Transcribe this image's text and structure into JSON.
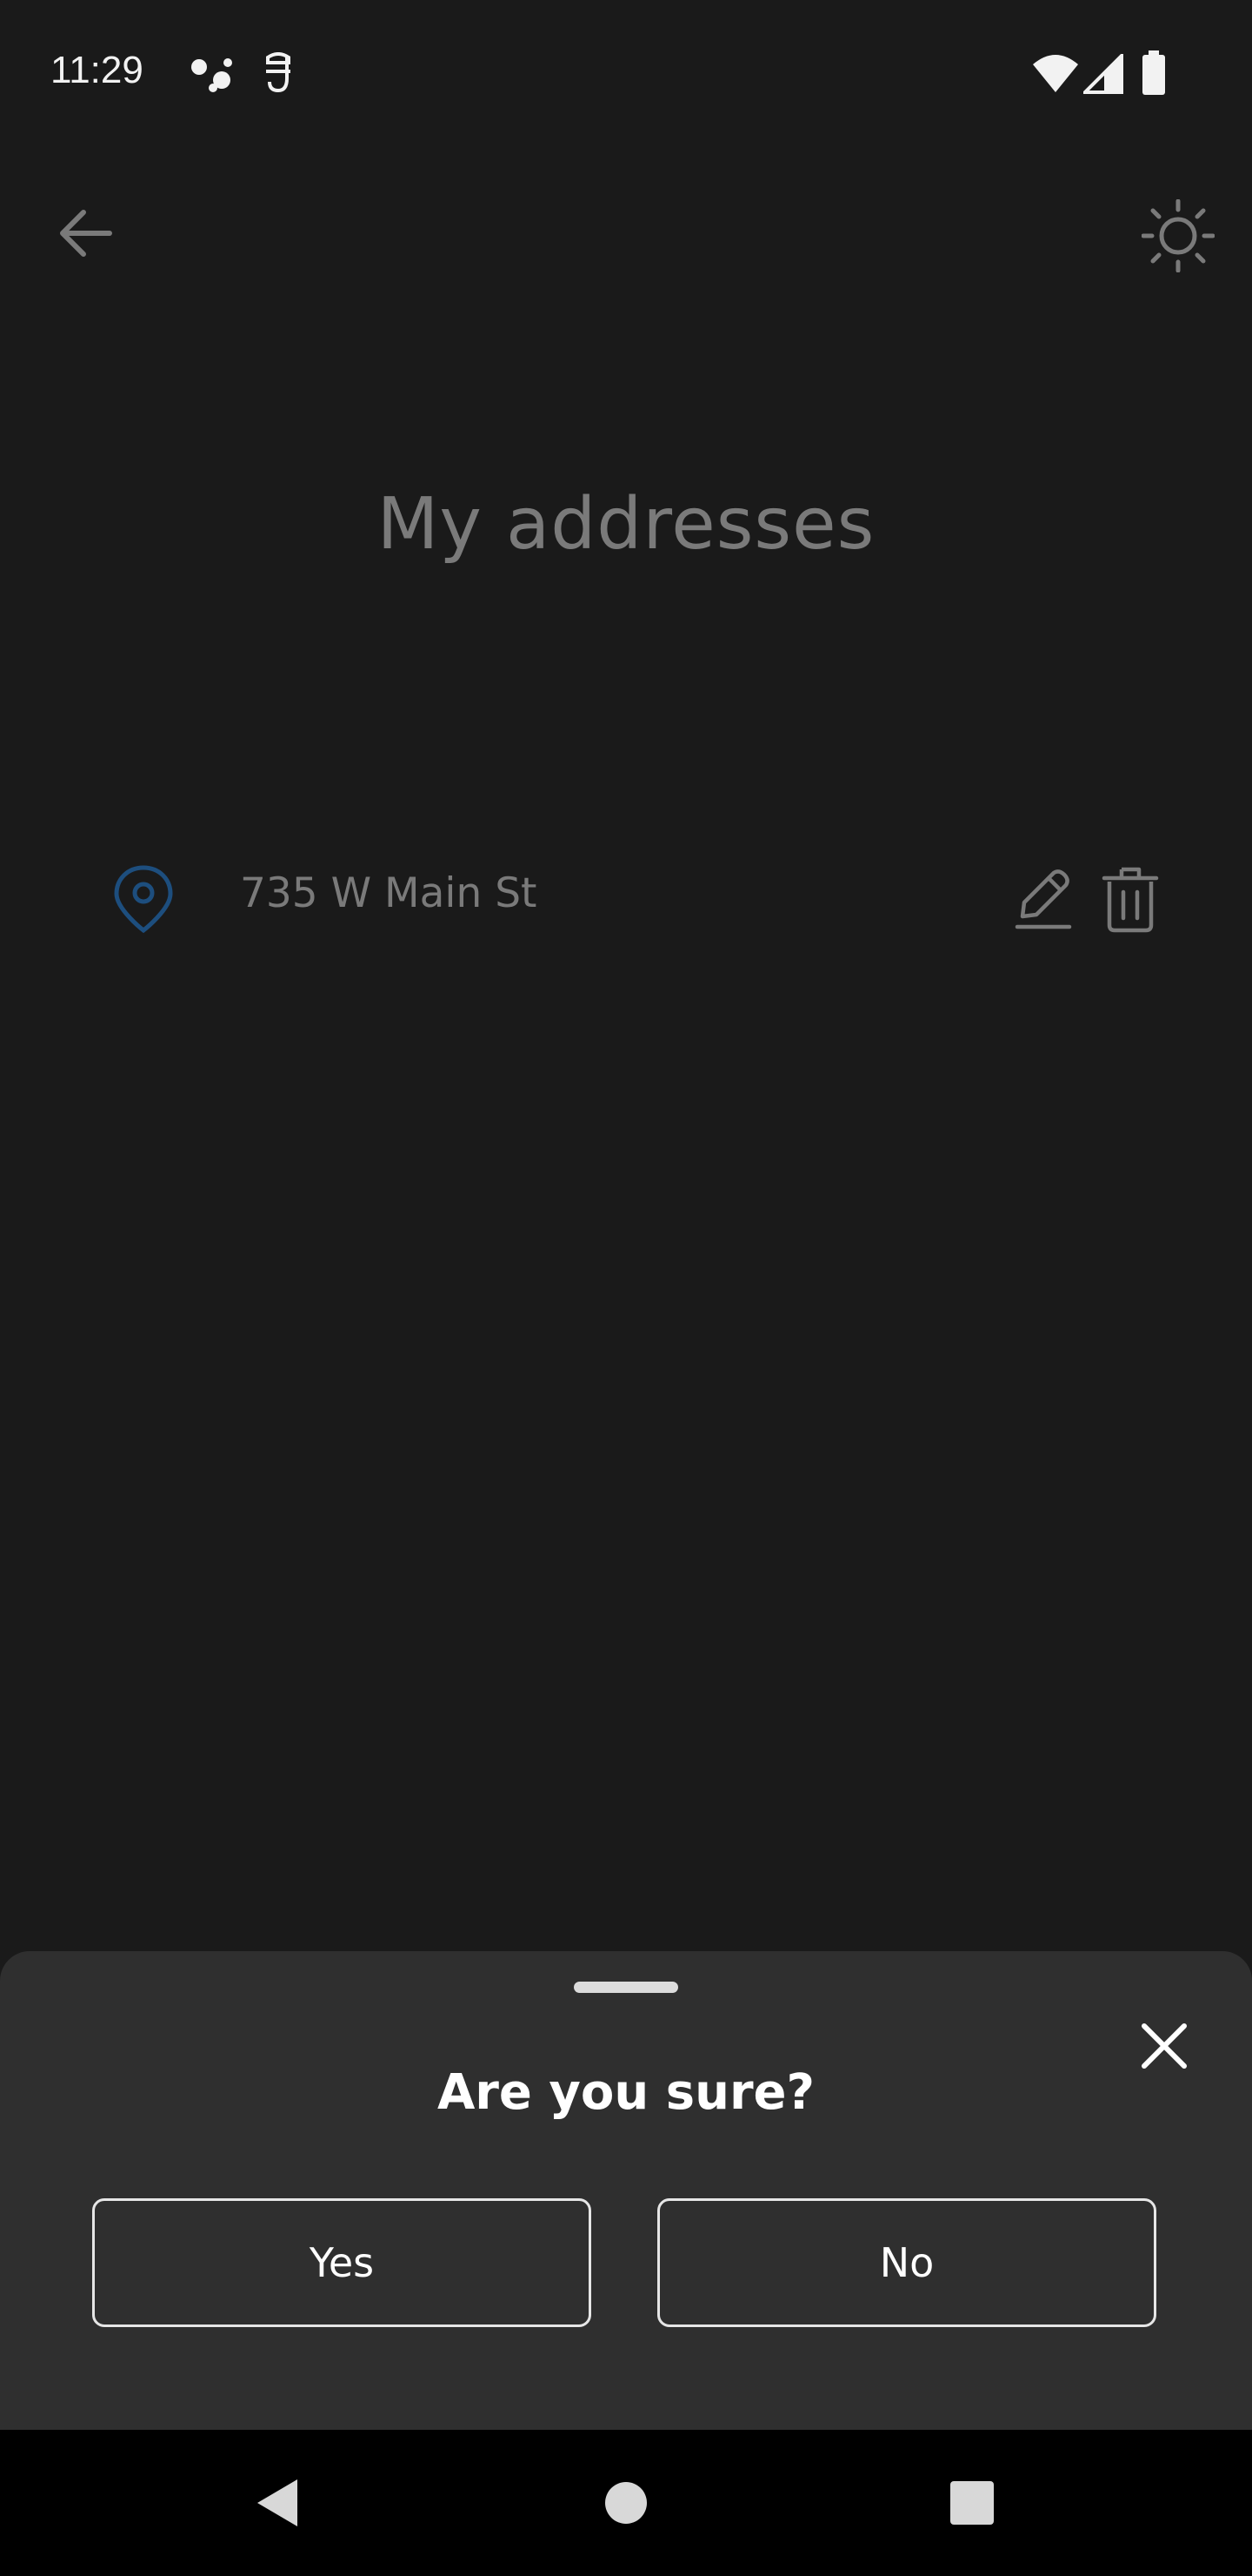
{
  "status_bar": {
    "time": "11:29"
  },
  "icons": {
    "back": "arrow-left-icon",
    "theme": "sun-icon",
    "location": "map-pin-icon",
    "edit": "pencil-icon",
    "delete": "trash-icon",
    "close": "close-icon"
  },
  "page": {
    "title": "My addresses"
  },
  "addresses": [
    {
      "label": "735 W Main St"
    }
  ],
  "dialog": {
    "title": "Are you sure?",
    "yes_label": "Yes",
    "no_label": "No"
  },
  "colors": {
    "background": "#1a1a1a",
    "sheet": "#2f2f2f",
    "pin_accent": "#1d4e7e",
    "muted_text": "#7a7a7a"
  }
}
